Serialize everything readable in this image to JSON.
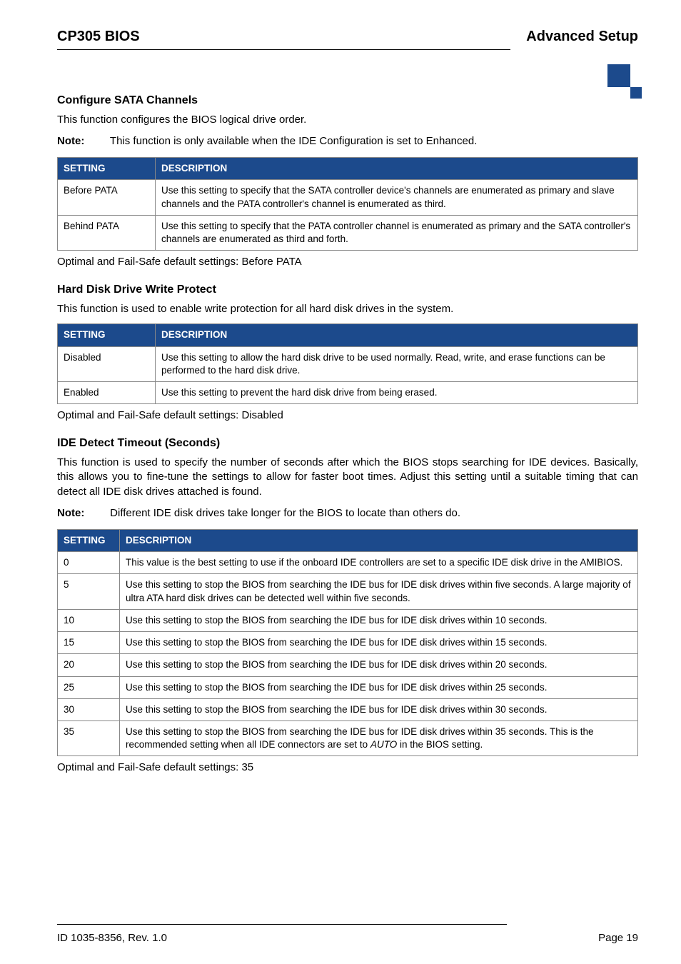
{
  "header": {
    "left": "CP305 BIOS",
    "right": "Advanced Setup"
  },
  "sections": {
    "sata": {
      "title": "Configure SATA Channels",
      "intro": "This function configures the BIOS logical drive order.",
      "note_label": "Note:",
      "note_text": "This function is only available when the IDE Configuration is set to Enhanced.",
      "th_setting": "SETTING",
      "th_desc": "DESCRIPTION",
      "rows": [
        {
          "s": "Before PATA",
          "d": "Use this setting to specify that the SATA controller device's channels are enumerated as primary and slave channels and the PATA controller's channel is enumerated as third."
        },
        {
          "s": "Behind PATA",
          "d": "Use this setting to specify that the PATA controller channel is enumerated as primary and the SATA controller's channels are enumerated as third and forth."
        }
      ],
      "default": "Optimal and Fail-Safe default settings: Before PATA"
    },
    "hdd": {
      "title": "Hard Disk Drive Write Protect",
      "intro": "This function is used to enable write protection for all hard disk drives in the system.",
      "th_setting": "SETTING",
      "th_desc": "DESCRIPTION",
      "rows": [
        {
          "s": "Disabled",
          "d": "Use this setting to allow the hard disk drive to be used normally. Read, write, and erase functions can be performed to the hard disk drive."
        },
        {
          "s": "Enabled",
          "d": "Use this setting to prevent the hard disk drive from being erased."
        }
      ],
      "default": "Optimal and Fail-Safe default settings: Disabled"
    },
    "ide": {
      "title": "IDE Detect Timeout (Seconds)",
      "intro": "This function is used to specify the number of seconds after which the BIOS stops searching for IDE devices. Basically, this allows you to fine-tune the settings to allow for faster boot times. Adjust this setting until a suitable timing that can detect all IDE disk drives attached is found.",
      "note_label": "Note:",
      "note_text": "Different IDE disk drives take longer for the BIOS to locate than others do.",
      "th_setting": "SETTING",
      "th_desc": "DESCRIPTION",
      "rows": [
        {
          "s": "0",
          "d": "This value is the best setting to use if the onboard IDE controllers are set to a specific IDE disk drive in the AMIBIOS."
        },
        {
          "s": "5",
          "d": "Use this setting to stop the BIOS from searching the IDE bus for IDE disk drives within five seconds. A large majority of ultra ATA hard disk drives can be detected well within five seconds."
        },
        {
          "s": "10",
          "d": "Use this setting to stop the BIOS from searching the IDE bus for IDE disk drives within 10 seconds."
        },
        {
          "s": "15",
          "d": "Use this setting to stop the BIOS from searching the IDE bus for IDE disk drives within 15 seconds."
        },
        {
          "s": "20",
          "d": "Use this setting to stop the BIOS from searching the IDE bus for IDE disk drives within 20 seconds."
        },
        {
          "s": "25",
          "d": "Use this setting to stop the BIOS from searching the IDE bus for IDE disk drives within 25 seconds."
        },
        {
          "s": "30",
          "d": "Use this setting to stop the BIOS from searching the IDE bus for IDE disk drives within 30 seconds."
        },
        {
          "s": "35",
          "d_pre": "Use this setting to stop the BIOS from searching the IDE bus for IDE disk drives within 35 seconds. This is the recommended setting when all IDE connectors are set to ",
          "d_em": "AUTO",
          "d_post": " in the BIOS setting."
        }
      ],
      "default": "Optimal and Fail-Safe default settings: 35"
    }
  },
  "footer": {
    "left": "ID 1035-8356, Rev. 1.0",
    "right": "Page 19"
  }
}
